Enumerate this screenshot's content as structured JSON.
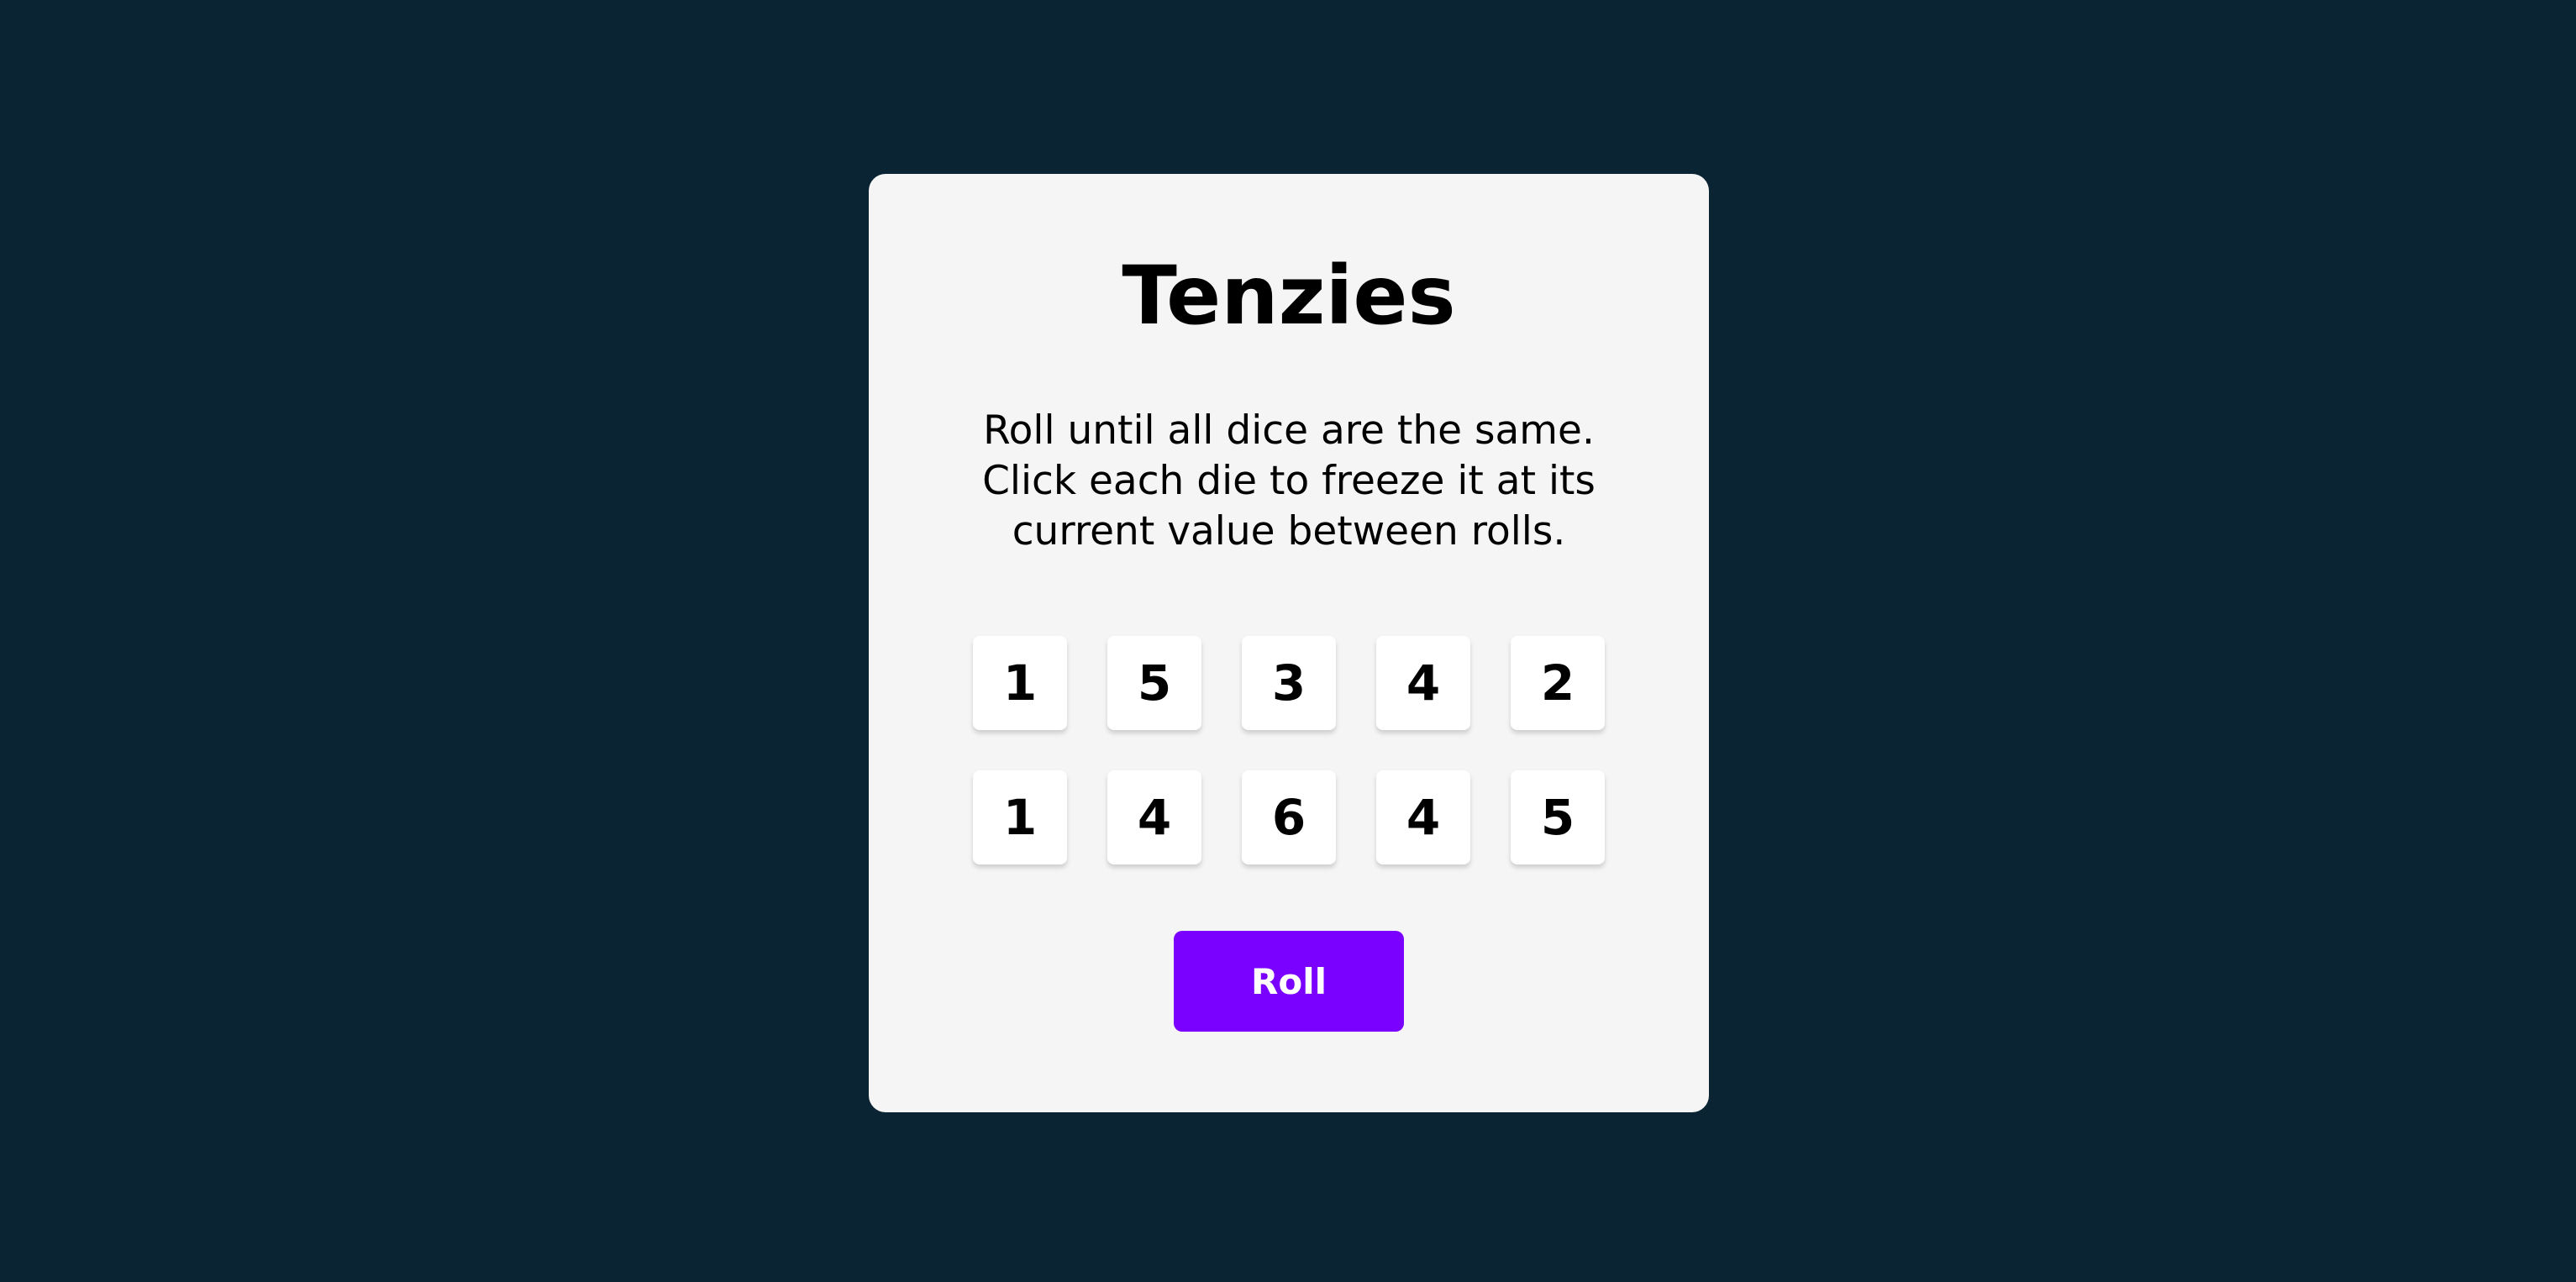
{
  "app": {
    "title": "Tenzies",
    "instructions": "Roll until all dice are the same. Click each die to freeze it at its current value between rolls."
  },
  "dice": [
    {
      "value": "1",
      "held": false
    },
    {
      "value": "5",
      "held": false
    },
    {
      "value": "3",
      "held": false
    },
    {
      "value": "4",
      "held": false
    },
    {
      "value": "2",
      "held": false
    },
    {
      "value": "1",
      "held": false
    },
    {
      "value": "4",
      "held": false
    },
    {
      "value": "6",
      "held": false
    },
    {
      "value": "4",
      "held": false
    },
    {
      "value": "5",
      "held": false
    }
  ],
  "roll_button": {
    "label": "Roll"
  },
  "colors": {
    "background": "#0B2434",
    "card": "#F5F5F5",
    "die": "#FFFFFF",
    "button": "#7A00FF",
    "button_text": "#FFFFFF",
    "text": "#000000"
  }
}
